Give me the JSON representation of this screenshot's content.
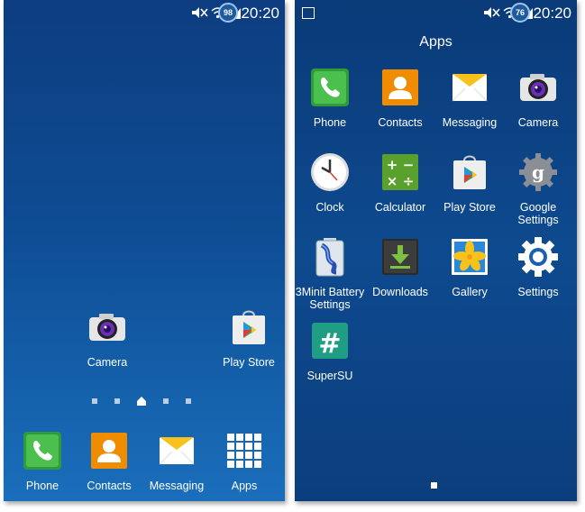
{
  "status": {
    "time": "20:20",
    "time_right": "20:20",
    "badge_left": "98",
    "badge_right": "76"
  },
  "home": {
    "shortcuts": [
      {
        "label": "Camera",
        "icon": "camera-icon"
      },
      {
        "label": "Play Store",
        "icon": "play-store-icon"
      }
    ],
    "dock": [
      {
        "label": "Phone",
        "icon": "phone-icon"
      },
      {
        "label": "Contacts",
        "icon": "contacts-icon"
      },
      {
        "label": "Messaging",
        "icon": "messaging-icon"
      },
      {
        "label": "Apps",
        "icon": "apps-grid-icon"
      }
    ]
  },
  "drawer": {
    "title": "Apps",
    "apps": [
      {
        "label": "Phone",
        "icon": "phone-icon"
      },
      {
        "label": "Contacts",
        "icon": "contacts-icon"
      },
      {
        "label": "Messaging",
        "icon": "messaging-icon"
      },
      {
        "label": "Camera",
        "icon": "camera-icon"
      },
      {
        "label": "Clock",
        "icon": "clock-icon"
      },
      {
        "label": "Calculator",
        "icon": "calculator-icon"
      },
      {
        "label": "Play Store",
        "icon": "play-store-icon"
      },
      {
        "label": "Google Settings",
        "icon": "google-settings-icon"
      },
      {
        "label": "3Minit Battery Settings",
        "icon": "battery-icon"
      },
      {
        "label": "Downloads",
        "icon": "downloads-icon"
      },
      {
        "label": "Gallery",
        "icon": "gallery-icon"
      },
      {
        "label": "Settings",
        "icon": "settings-gear-icon"
      },
      {
        "label": "SuperSU",
        "icon": "supersu-icon"
      }
    ]
  },
  "colors": {
    "wallpaper_top": "#0d3d80",
    "wallpaper_bottom": "#1a6ebb",
    "text": "#ffffff"
  }
}
